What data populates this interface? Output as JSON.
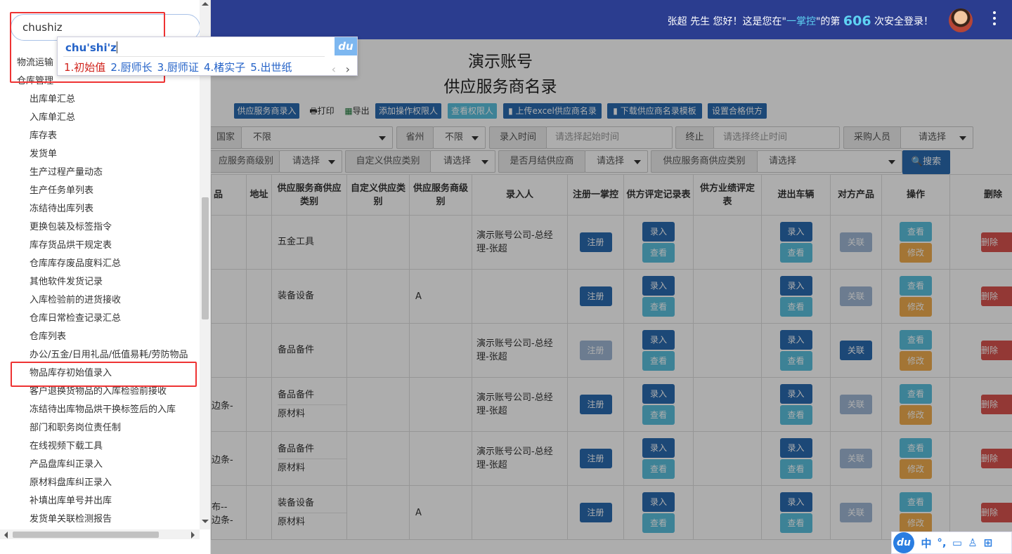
{
  "header": {
    "welcome_prefix": "张超 先生 您好！这是您在\"",
    "brand": "一掌控",
    "welcome_mid": "\"的第",
    "login_count": "606",
    "welcome_suffix": "次安全登录！"
  },
  "page": {
    "title": "演示账号",
    "subtitle": "供应服务商名录"
  },
  "toolbar": {
    "enter": "供应服务商录入",
    "print": "打印",
    "export": "导出",
    "add_perm": "添加操作权限人",
    "view_perm": "查看权限人",
    "upload_excel": "上传excel供应商名录",
    "download_tpl": "下载供应商名录模板",
    "set_qualified": "设置合格供方"
  },
  "filters": {
    "country_label": "国家",
    "country_value": "不限",
    "province_label": "省州",
    "province_value": "不限",
    "entry_time_label": "录入时间",
    "start_placeholder": "请选择起始时间",
    "end_label": "终止",
    "end_placeholder": "请选择终止时间",
    "buyer_label": "采购人员",
    "buyer_value": "请选择",
    "level_label": "应服务商级别",
    "level_value": "请选择",
    "custom_cat_label": "自定义供应类别",
    "custom_cat_value": "请选择",
    "monthly_label": "是否月结供应商",
    "monthly_value": "请选择",
    "supply_cat_label": "供应服务商供应类别",
    "supply_cat_value": "请选择",
    "search": "搜索"
  },
  "table": {
    "headers": [
      "品",
      "地址",
      "供应服务商供应类别",
      "自定义供应类别",
      "供应服务商级别",
      "录入人",
      "注册一掌控",
      "供方评定记录表",
      "供方业绩评定表",
      "进出车辆",
      "对方产品",
      "操作",
      "删除"
    ],
    "rows": [
      {
        "c0": "",
        "cat": [
          "五金工具"
        ],
        "level": "",
        "entry": "演示账号公司-总经理-张超"
      },
      {
        "c0": "",
        "cat": [
          "装备设备"
        ],
        "level": "A",
        "entry": ""
      },
      {
        "c0": "",
        "cat": [
          "备品备件"
        ],
        "level": "",
        "entry": "演示账号公司-总经理-张超"
      },
      {
        "c0": "边条-",
        "cat": [
          "备品备件",
          "原材料"
        ],
        "level": "",
        "entry": "演示账号公司-总经理-张超"
      },
      {
        "c0": "边条-",
        "cat": [
          "备品备件",
          "原材料"
        ],
        "level": "",
        "entry": "演示账号公司-总经理-张超"
      },
      {
        "c0": "布--\n边条-",
        "cat": [
          "装备设备",
          "原材料"
        ],
        "level": "A",
        "entry": ""
      }
    ],
    "btn_register": "注册",
    "btn_enter": "录入",
    "btn_view": "查看",
    "btn_link": "关联",
    "btn_edit": "修改",
    "btn_delete": "删除"
  },
  "sidebar": {
    "search_value": "chushiz",
    "top_items": [
      "物流运输",
      "仓库管理"
    ],
    "sub_items": [
      "出库单汇总",
      "入库单汇总",
      "库存表",
      "发货单",
      "生产过程产量动态",
      "生产任务单列表",
      "冻结待出库列表",
      "更换包装及标签指令",
      "库存货品烘干规定表",
      "仓库库存废品度料汇总",
      "其他软件发货记录",
      "入库检验前的进货接收",
      "仓库日常检查记录汇总",
      "仓库列表",
      "办公/五金/日用礼品/低值易耗/劳防物品",
      "物品库存初始值录入",
      "客户退换货物品的入库检验前接收",
      "冻结待出库物品烘干换标签后的入库",
      "部门和职务岗位责任制",
      "在线视频下载工具",
      "产品盘库纠正录入",
      "原材料盘库纠正录入",
      "补填出库单号并出库",
      "发货单关联检测报告"
    ]
  },
  "ime": {
    "composition": "chu'shi'z",
    "candidates": [
      "1.初始值",
      "2.厨师长",
      "3.厨师证",
      "4.楮实子",
      "5.出世纸"
    ],
    "logo": "du",
    "bar_items": [
      "中",
      "°,",
      "▭",
      "♙",
      "⊞"
    ]
  }
}
